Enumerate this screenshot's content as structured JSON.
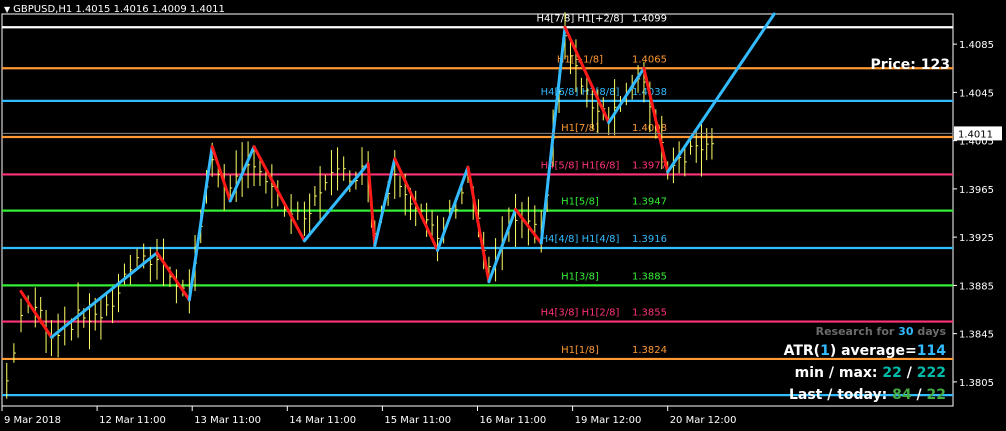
{
  "chart_title": "GBPUSD,H1  1.4015 1.4016 1.4009 1.4011",
  "price_label": "Price: 123",
  "panel": {
    "research_prefix": "Research for ",
    "research_days": "30",
    "research_suffix": " days",
    "atr_prefix": "ATR(",
    "atr_period": "1",
    "atr_mid": ") average=",
    "atr_value": "114",
    "minmax_prefix": "min / max: ",
    "min": "22",
    "sep": " / ",
    "max": "222",
    "last_prefix": "Last / today: ",
    "last": "84",
    "today": "22"
  },
  "colors": {
    "background": "#000000",
    "candles": "#ffff66",
    "zigzag_up": "#33bbff",
    "zigzag_down": "#ff1a1a",
    "level_white": "#ffffff",
    "level_orange": "#ff9933",
    "level_blue": "#33bbff",
    "level_pink": "#ff3377",
    "level_green": "#33ee33",
    "atr_cyan": "#33bbff",
    "min_color": "#00bbaa",
    "max_color": "#00bbaa",
    "last_color": "#44aa44",
    "today_color": "#44aa44"
  },
  "chart_data": {
    "type": "line",
    "symbol": "GBPUSD",
    "timeframe": "H1",
    "ylim": [
      1.3785,
      1.411
    ],
    "yticks": [
      "1.4085",
      "1.4045",
      "1.4005",
      "1.3965",
      "1.3925",
      "1.3885",
      "1.3845",
      "1.3805"
    ],
    "current_price": "1.4011",
    "xticks": [
      "9 Mar 2018",
      "12 Mar 11:00",
      "13 Mar 11:00",
      "14 Mar 11:00",
      "15 Mar 11:00",
      "16 Mar 11:00",
      "19 Mar 12:00",
      "20 Mar 12:00"
    ],
    "levels": [
      {
        "label": "H4[7/8] H1[+2/8]",
        "value": "1.4099",
        "price": 1.4099,
        "color": "white"
      },
      {
        "label": "H1[+1/8]",
        "value": "1.4065",
        "price": 1.4065,
        "color": "orange"
      },
      {
        "label": "H4[6/8] H1[8/8]",
        "value": "1.4038",
        "price": 1.4038,
        "color": "blue"
      },
      {
        "label": "H1[7/8]",
        "value": "1.4008",
        "price": 1.4008,
        "color": "orange"
      },
      {
        "label": "H4[5/8] H1[6/8]",
        "value": "1.3977",
        "price": 1.3977,
        "color": "pink"
      },
      {
        "label": "H1[5/8]",
        "value": "1.3947",
        "price": 1.3947,
        "color": "green"
      },
      {
        "label": "H4[4/8] H1[4/8]",
        "value": "1.3916",
        "price": 1.3916,
        "color": "blue"
      },
      {
        "label": "H1[3/8]",
        "value": "1.3885",
        "price": 1.3885,
        "color": "green"
      },
      {
        "label": "H4[3/8] H1[2/8]",
        "value": "1.3855",
        "price": 1.3855,
        "color": "pink"
      },
      {
        "label": "H1[1/8]",
        "value": "1.3824",
        "price": 1.3824,
        "color": "orange"
      },
      {
        "label": "",
        "value": "",
        "price": 1.3794,
        "color": "blue"
      }
    ],
    "zigzag": [
      {
        "t": 0.02,
        "p": 1.388
      },
      {
        "t": 0.052,
        "p": 1.3842
      },
      {
        "t": 0.163,
        "p": 1.3912
      },
      {
        "t": 0.197,
        "p": 1.3873
      },
      {
        "t": 0.221,
        "p": 1.4
      },
      {
        "t": 0.24,
        "p": 1.3955
      },
      {
        "t": 0.265,
        "p": 1.4
      },
      {
        "t": 0.318,
        "p": 1.3922
      },
      {
        "t": 0.385,
        "p": 1.3986
      },
      {
        "t": 0.392,
        "p": 1.3918
      },
      {
        "t": 0.413,
        "p": 1.399
      },
      {
        "t": 0.458,
        "p": 1.3914
      },
      {
        "t": 0.49,
        "p": 1.3983
      },
      {
        "t": 0.512,
        "p": 1.3888
      },
      {
        "t": 0.54,
        "p": 1.3948
      },
      {
        "t": 0.567,
        "p": 1.392
      },
      {
        "t": 0.592,
        "p": 1.4099
      },
      {
        "t": 0.638,
        "p": 1.402
      },
      {
        "t": 0.675,
        "p": 1.4065
      },
      {
        "t": 0.7,
        "p": 1.3979
      },
      {
        "t": 0.812,
        "p": 1.411
      }
    ],
    "price_path": [
      {
        "t": 0.005,
        "p": 1.3805
      },
      {
        "t": 0.02,
        "p": 1.386
      },
      {
        "t": 0.035,
        "p": 1.3868
      },
      {
        "t": 0.052,
        "p": 1.3845
      },
      {
        "t": 0.08,
        "p": 1.3858
      },
      {
        "t": 0.11,
        "p": 1.3862
      },
      {
        "t": 0.135,
        "p": 1.39
      },
      {
        "t": 0.163,
        "p": 1.3908
      },
      {
        "t": 0.197,
        "p": 1.3878
      },
      {
        "t": 0.221,
        "p": 1.399
      },
      {
        "t": 0.24,
        "p": 1.3962
      },
      {
        "t": 0.265,
        "p": 1.399
      },
      {
        "t": 0.29,
        "p": 1.3955
      },
      {
        "t": 0.318,
        "p": 1.3935
      },
      {
        "t": 0.34,
        "p": 1.3975
      },
      {
        "t": 0.385,
        "p": 1.398
      },
      {
        "t": 0.392,
        "p": 1.3928
      },
      {
        "t": 0.413,
        "p": 1.3982
      },
      {
        "t": 0.435,
        "p": 1.395
      },
      {
        "t": 0.458,
        "p": 1.3922
      },
      {
        "t": 0.49,
        "p": 1.3975
      },
      {
        "t": 0.512,
        "p": 1.3895
      },
      {
        "t": 0.54,
        "p": 1.394
      },
      {
        "t": 0.567,
        "p": 1.3925
      },
      {
        "t": 0.592,
        "p": 1.4088
      },
      {
        "t": 0.615,
        "p": 1.404
      },
      {
        "t": 0.638,
        "p": 1.4028
      },
      {
        "t": 0.675,
        "p": 1.4055
      },
      {
        "t": 0.7,
        "p": 1.3985
      },
      {
        "t": 0.73,
        "p": 1.4
      },
      {
        "t": 0.752,
        "p": 1.4012
      }
    ]
  }
}
